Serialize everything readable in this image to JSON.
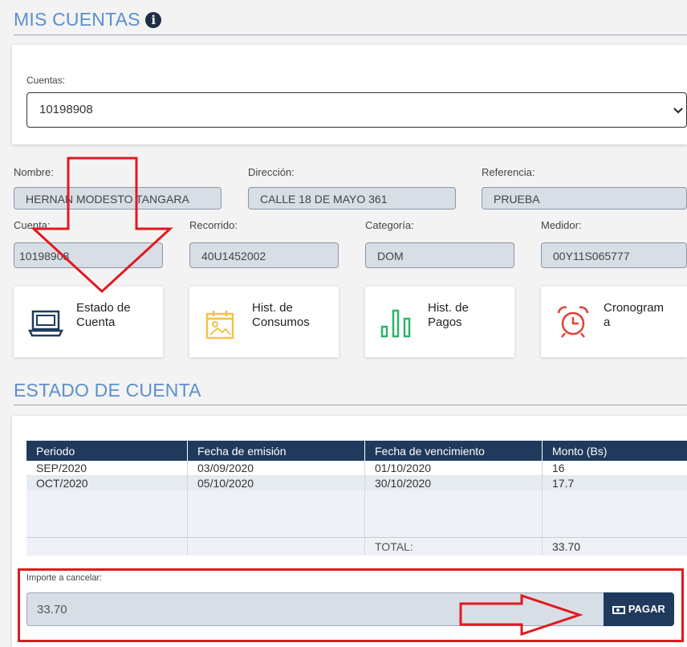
{
  "header": {
    "title": "MIS CUENTAS"
  },
  "account_select": {
    "label": "Cuentas:",
    "value": "10198908"
  },
  "fields": {
    "nombre": {
      "label": "Nombre:",
      "value": "HERNAN MODESTO TANGARA"
    },
    "direccion": {
      "label": "Dirección:",
      "value": "CALLE 18 DE MAYO 361"
    },
    "referencia": {
      "label": "Referencia:",
      "value": "PRUEBA"
    },
    "cuenta": {
      "label": "Cuenta:",
      "value": "10198908"
    },
    "recorrido": {
      "label": "Recorrido:",
      "value": "40U1452002"
    },
    "categoria": {
      "label": "Categoría:",
      "value": "DOM"
    },
    "medidor": {
      "label": "Medidor:",
      "value": "00Y11S065777"
    }
  },
  "tiles": [
    {
      "label": "Estado de\nCuenta",
      "icon": "laptop-icon",
      "color": "#1f3a5c"
    },
    {
      "label": "Hist. de\nConsumos",
      "icon": "calendar-image-icon",
      "color": "#f2c14e"
    },
    {
      "label": "Hist. de\nPagos",
      "icon": "bar-chart-icon",
      "color": "#2fb36b"
    },
    {
      "label": "Cronogram\na",
      "icon": "alarm-clock-icon",
      "color": "#e0423a"
    }
  ],
  "estado": {
    "title": "ESTADO DE CUENTA",
    "columns": [
      "Periodo",
      "Fecha de emisión",
      "Fecha de vencimiento",
      "Monto (Bs)"
    ],
    "rows": [
      [
        "SEP/2020",
        "03/09/2020",
        "01/10/2020",
        "16"
      ],
      [
        "OCT/2020",
        "05/10/2020",
        "30/10/2020",
        "17.7"
      ]
    ],
    "total_label": "TOTAL:",
    "total_value": "33.70"
  },
  "payment": {
    "label": "Importe a cancelar:",
    "amount": "33.70",
    "button_label": "PAGAR"
  },
  "colors": {
    "accent": "#5b8fd0",
    "header": "#1f3a5c",
    "annotation": "#e0191f"
  }
}
